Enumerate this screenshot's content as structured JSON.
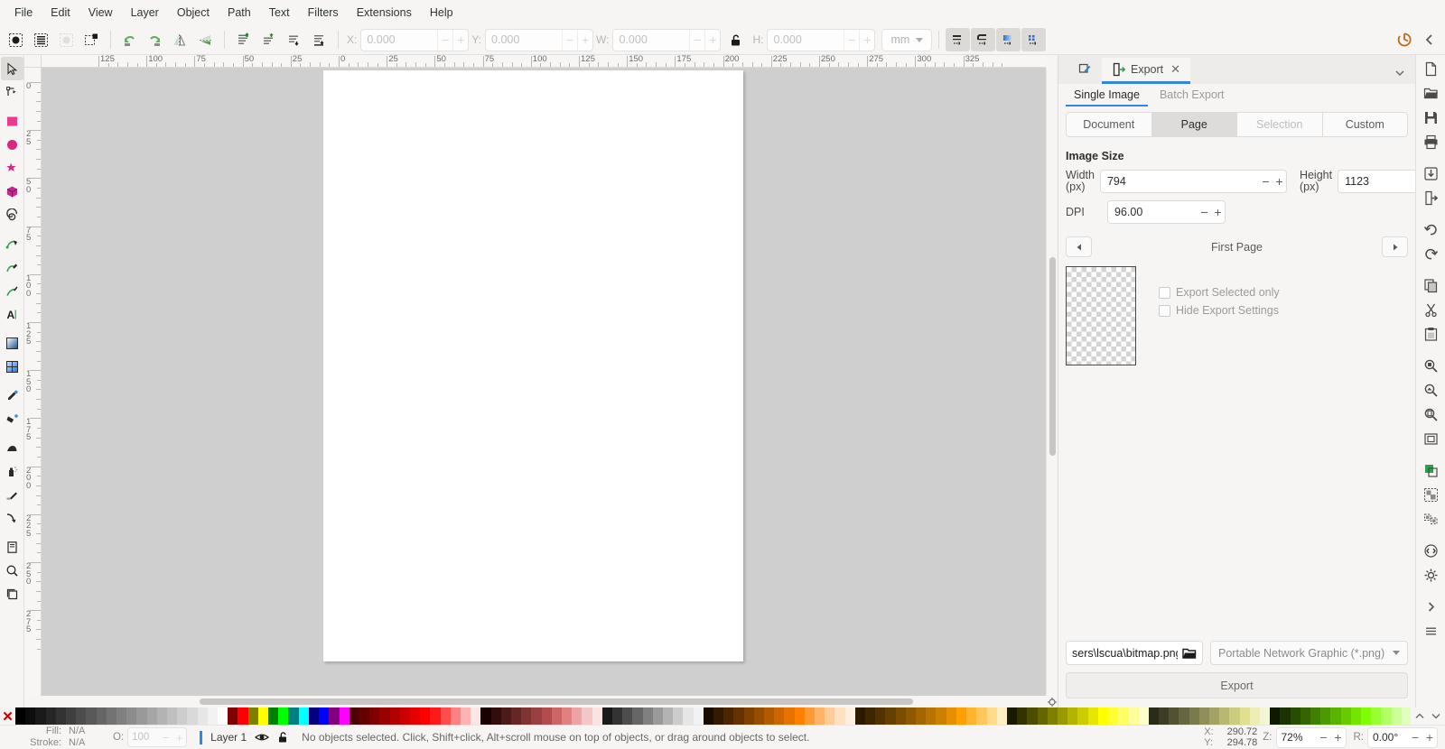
{
  "menubar": {
    "items": [
      {
        "label": "File"
      },
      {
        "label": "Edit"
      },
      {
        "label": "View"
      },
      {
        "label": "Layer"
      },
      {
        "label": "Object"
      },
      {
        "label": "Path"
      },
      {
        "label": "Text"
      },
      {
        "label": "Filters"
      },
      {
        "label": "Extensions"
      },
      {
        "label": "Help"
      }
    ]
  },
  "toolcontrols": {
    "x": {
      "label": "X:",
      "value": "0.000"
    },
    "y": {
      "label": "Y:",
      "value": "0.000"
    },
    "w": {
      "label": "W:",
      "value": "0.000"
    },
    "h": {
      "label": "H:",
      "value": "0.000"
    },
    "unit": "mm",
    "lock_icon": "lock-open-icon",
    "select_all_icon": "select-all-icon",
    "select_all_layers_icon": "select-all-in-all-layers-icon",
    "deselect_icon": "deselect-icon",
    "select_same_icon": "select-same-icon",
    "rotate_ccw_icon": "rotate-counter-clockwise-icon",
    "rotate_cw_icon": "rotate-clockwise-icon",
    "flip_h_icon": "flip-horizontal-icon",
    "flip_v_icon": "flip-vertical-icon",
    "raise_top_icon": "raise-to-top-icon",
    "raise_icon": "raise-icon",
    "lower_icon": "lower-icon",
    "lower_bottom_icon": "lower-to-bottom-icon",
    "affect_stroke_icon": "scale-stroke-width-icon",
    "affect_corners_icon": "scale-rounded-corners-icon",
    "affect_gradient_icon": "transform-gradients-icon",
    "affect_pattern_icon": "transform-patterns-icon",
    "snap_icon": "snap-controls-icon",
    "collapse_icon": "collapse-panel-icon"
  },
  "toolbox": {
    "tools": [
      {
        "name": "selector-tool",
        "icon": "arrow-cursor-icon",
        "active": true
      },
      {
        "name": "node-tool",
        "icon": "node-editor-icon",
        "active": false
      },
      {
        "name": "rectangle-tool",
        "icon": "square-icon",
        "active": false
      },
      {
        "name": "ellipse-tool",
        "icon": "circle-icon",
        "active": false
      },
      {
        "name": "star-tool",
        "icon": "star-icon",
        "active": false
      },
      {
        "name": "box3d-tool",
        "icon": "cube-icon",
        "active": false
      },
      {
        "name": "spiral-tool",
        "icon": "spiral-icon",
        "active": false
      },
      {
        "name": "pen-tool",
        "icon": "bezier-pen-icon",
        "active": false
      },
      {
        "name": "pencil-tool",
        "icon": "pencil-icon",
        "active": false
      },
      {
        "name": "calligraphy-tool",
        "icon": "calligraphy-brush-icon",
        "active": false
      },
      {
        "name": "text-tool",
        "icon": "text-a-icon",
        "active": false
      },
      {
        "name": "gradient-tool",
        "icon": "gradient-square-icon",
        "active": false
      },
      {
        "name": "mesh-gradient-tool",
        "icon": "mesh-gradient-icon",
        "active": false
      },
      {
        "name": "dropper-tool",
        "icon": "eyedropper-icon",
        "active": false
      },
      {
        "name": "paint-bucket-tool",
        "icon": "paint-bucket-icon",
        "active": false
      },
      {
        "name": "tweak-tool",
        "icon": "tweak-hand-icon",
        "active": false
      },
      {
        "name": "spray-tool",
        "icon": "spray-can-icon",
        "active": false
      },
      {
        "name": "eraser-tool",
        "icon": "eraser-icon",
        "active": false
      },
      {
        "name": "connector-tool",
        "icon": "connector-arrow-icon",
        "active": false
      },
      {
        "name": "pages-tool",
        "icon": "page-icon",
        "active": false
      },
      {
        "name": "zoom-tool",
        "icon": "magnifier-icon",
        "active": false
      },
      {
        "name": "measure-tool",
        "icon": "measure-copies-icon",
        "active": false
      }
    ]
  },
  "rulers": {
    "horizontal": {
      "labels": [
        "125",
        "100",
        "75",
        "50",
        "25",
        "0",
        "25",
        "50",
        "75",
        "100",
        "125",
        "150",
        "175",
        "200",
        "225",
        "250",
        "275",
        "300",
        "325"
      ],
      "unit": "mm"
    },
    "vertical": {
      "labels": [
        "0",
        "25",
        "50",
        "75",
        "100",
        "125",
        "150",
        "175",
        "200",
        "225",
        "250",
        "275"
      ],
      "unit": "mm"
    }
  },
  "canvas": {
    "page_color": "#ffffff",
    "background_color": "#cfcfcf"
  },
  "dock": {
    "tabs": [
      {
        "label": "",
        "icon": "object-properties-icon",
        "selected": false,
        "closable": false
      },
      {
        "label": "Export",
        "icon": "export-doc-icon",
        "selected": true,
        "closable": true,
        "close_label": "✕"
      }
    ],
    "expand_icon": "chevron-down-icon",
    "subtabs": [
      {
        "label": "Single Image",
        "selected": true
      },
      {
        "label": "Batch Export",
        "selected": false
      }
    ],
    "scope_segments": [
      {
        "label": "Document",
        "state": "normal"
      },
      {
        "label": "Page",
        "state": "selected"
      },
      {
        "label": "Selection",
        "state": "disabled"
      },
      {
        "label": "Custom",
        "state": "normal"
      }
    ],
    "image_size": {
      "title": "Image Size",
      "width": {
        "label": "Width",
        "unit": "(px)",
        "value": "794"
      },
      "height": {
        "label": "Height",
        "unit": "(px)",
        "value": "1123"
      },
      "dpi": {
        "label": "DPI",
        "value": "96.00"
      }
    },
    "page_nav": {
      "prev_icon": "triangle-left-icon",
      "label": "First Page",
      "next_icon": "triangle-right-icon"
    },
    "preview": {
      "name": "export-preview-thumbnail"
    },
    "checkboxes": [
      {
        "label": "Export Selected only",
        "checked": false
      },
      {
        "label": "Hide Export Settings",
        "checked": false
      }
    ],
    "filename": {
      "value": "sers\\lscua\\bitmap.png",
      "folder_icon": "open-folder-icon"
    },
    "format": {
      "value": "Portable Network Graphic (*.png)",
      "caret": "chevron-down-icon"
    },
    "export_button": "Export"
  },
  "cmdbar": {
    "items": [
      {
        "name": "new-document-button",
        "icon": "new-file-icon"
      },
      {
        "name": "open-document-button",
        "icon": "open-folder-icon"
      },
      {
        "name": "save-document-button",
        "icon": "save-disk-icon"
      },
      {
        "name": "print-document-button",
        "icon": "printer-icon"
      },
      {
        "name": "import-button",
        "icon": "import-icon"
      },
      {
        "name": "export-button",
        "icon": "export-icon"
      },
      {
        "name": "undo-button",
        "icon": "undo-arrow-icon"
      },
      {
        "name": "redo-button",
        "icon": "redo-arrow-icon"
      },
      {
        "name": "copy-button",
        "icon": "copy-icon"
      },
      {
        "name": "cut-button",
        "icon": "scissors-icon"
      },
      {
        "name": "paste-button",
        "icon": "clipboard-icon"
      },
      {
        "name": "zoom-selection-button",
        "icon": "zoom-selection-icon"
      },
      {
        "name": "zoom-drawing-button",
        "icon": "zoom-drawing-icon"
      },
      {
        "name": "zoom-page-button",
        "icon": "zoom-page-icon"
      },
      {
        "name": "zoom-fit-button",
        "icon": "zoom-fit-icon"
      },
      {
        "name": "duplicate-button",
        "icon": "duplicate-icon"
      },
      {
        "name": "group-button",
        "icon": "group-icon"
      },
      {
        "name": "ungroup-button",
        "icon": "ungroup-icon"
      },
      {
        "name": "xml-editor-button",
        "icon": "xml-editor-icon"
      },
      {
        "name": "preferences-button",
        "icon": "gear-icon"
      },
      {
        "name": "expand-panel-button",
        "icon": "triangle-right-icon"
      },
      {
        "name": "more-options-button",
        "icon": "hamburger-icon"
      }
    ]
  },
  "palette": {
    "none_label": "✕",
    "colors": [
      "#000000",
      "#0d0d0d",
      "#1a1a1a",
      "#262626",
      "#333333",
      "#404040",
      "#4d4d4d",
      "#595959",
      "#666666",
      "#737373",
      "#808080",
      "#8c8c8c",
      "#999999",
      "#a6a6a6",
      "#b3b3b3",
      "#bfbfbf",
      "#cccccc",
      "#d9d9d9",
      "#e6e6e6",
      "#f2f2f2",
      "#ffffff",
      "#800000",
      "#ff0000",
      "#808000",
      "#ffff00",
      "#008000",
      "#00ff00",
      "#008080",
      "#00ffff",
      "#000080",
      "#0000ff",
      "#800080",
      "#ff00ff",
      "#4d0000",
      "#660000",
      "#800000",
      "#990000",
      "#b30000",
      "#cc0000",
      "#e60000",
      "#ff0000",
      "#ff1a1a",
      "#ff4d4d",
      "#ff8080",
      "#ffb3b3",
      "#ffe6e6",
      "#1a0000",
      "#330d0d",
      "#4d1a1a",
      "#662626",
      "#803333",
      "#994040",
      "#b34d4d",
      "#cc6666",
      "#e08080",
      "#eba3a3",
      "#f5c6c6",
      "#fae3e3",
      "#1a1a1a",
      "#333333",
      "#4d4d4d",
      "#666666",
      "#808080",
      "#999999",
      "#b3b3b3",
      "#cccccc",
      "#e6e6e6",
      "#f2f2f2",
      "#1a0d00",
      "#331a00",
      "#4d2600",
      "#663300",
      "#804000",
      "#994d00",
      "#b35900",
      "#cc6600",
      "#e67300",
      "#ff8000",
      "#ff9933",
      "#ffb366",
      "#ffcc99",
      "#ffe0bf",
      "#fff0e0",
      "#2b1a00",
      "#3d2600",
      "#523300",
      "#664000",
      "#7a4d00",
      "#8f5900",
      "#a36600",
      "#b87300",
      "#cc8000",
      "#e68f00",
      "#ff9f00",
      "#ffb32e",
      "#ffc75c",
      "#ffdb8a",
      "#ffeec2",
      "#1a1a00",
      "#333300",
      "#4d4d00",
      "#666600",
      "#808000",
      "#999900",
      "#b3b300",
      "#cccc00",
      "#e6e600",
      "#ffff00",
      "#ffff33",
      "#ffff66",
      "#ffff99",
      "#ffffcc",
      "#2b2b1a",
      "#3d3d26",
      "#525233",
      "#666640",
      "#7a7a4d",
      "#8f8f59",
      "#a3a366",
      "#b8b873",
      "#cccc80",
      "#e0e08f",
      "#ededb5",
      "#f5f5d6",
      "#0d1a00",
      "#1a3300",
      "#264d00",
      "#336600",
      "#408000",
      "#4d9900",
      "#59b300",
      "#66cc00",
      "#73e600",
      "#80ff00",
      "#99ff33",
      "#b3ff66",
      "#ccff99",
      "#e0ffbf"
    ],
    "scroll_up_icon": "chevron-up-icon",
    "scroll_down_icon": "chevron-down-icon"
  },
  "statusbar": {
    "fill": {
      "label": "Fill:",
      "value": "N/A"
    },
    "stroke": {
      "label": "Stroke:",
      "value": "N/A"
    },
    "opacity": {
      "label": "O:",
      "value": "100"
    },
    "layer": {
      "name": "Layer 1",
      "visibility_icon": "eye-icon",
      "lock_icon": "lock-open-icon"
    },
    "message": "No objects selected. Click, Shift+click, Alt+scroll mouse on top of objects, or drag around objects to select.",
    "pointer": {
      "x_label": "X:",
      "x_value": "290.72",
      "y_label": "Y:",
      "y_value": "294.78"
    },
    "zoom": {
      "label": "Z:",
      "value": "72%"
    },
    "rotation": {
      "label": "R:",
      "value": "0.00°"
    }
  }
}
